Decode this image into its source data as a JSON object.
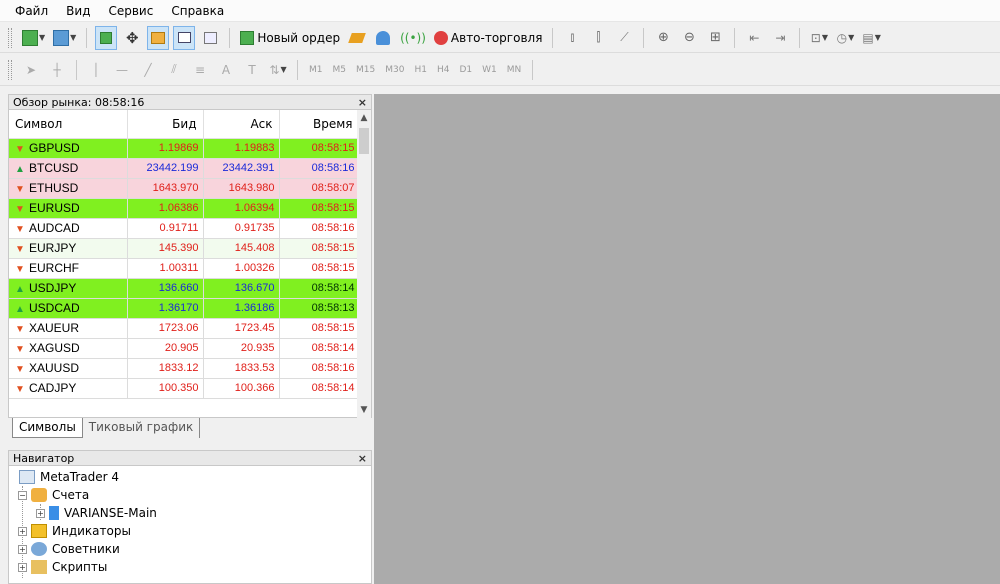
{
  "menu": [
    "Файл",
    "Вид",
    "Сервис",
    "Справка"
  ],
  "toolbar": {
    "new_order": "Новый ордер",
    "auto_trading": "Авто-торговля"
  },
  "timeframes": [
    "M1",
    "M5",
    "M15",
    "M30",
    "H1",
    "H4",
    "D1",
    "W1",
    "MN"
  ],
  "market_watch": {
    "title": "Обзор рынка: 08:58:16",
    "close": "×",
    "columns": [
      "Символ",
      "Бид",
      "Аск",
      "Время"
    ],
    "rows": [
      {
        "symbol": "GBPUSD",
        "bid": "1.19869",
        "ask": "1.19883",
        "time": "08:58:15",
        "dir": "down",
        "bg": "#80f020",
        "color": "red"
      },
      {
        "symbol": "BTCUSD",
        "bid": "23442.199",
        "ask": "23442.391",
        "time": "08:58:16",
        "dir": "up",
        "bg": "#f8d4dc",
        "color": "blue"
      },
      {
        "symbol": "ETHUSD",
        "bid": "1643.970",
        "ask": "1643.980",
        "time": "08:58:07",
        "dir": "down",
        "bg": "#f8d4dc",
        "color": "red"
      },
      {
        "symbol": "EURUSD",
        "bid": "1.06386",
        "ask": "1.06394",
        "time": "08:58:15",
        "dir": "down",
        "bg": "#80f020",
        "color": "red"
      },
      {
        "symbol": "AUDCAD",
        "bid": "0.91711",
        "ask": "0.91735",
        "time": "08:58:16",
        "dir": "down",
        "bg": "#ffffff",
        "color": "red"
      },
      {
        "symbol": "EURJPY",
        "bid": "145.390",
        "ask": "145.408",
        "time": "08:58:15",
        "dir": "down",
        "bg": "#f2fbee",
        "color": "red"
      },
      {
        "symbol": "EURCHF",
        "bid": "1.00311",
        "ask": "1.00326",
        "time": "08:58:15",
        "dir": "down",
        "bg": "#ffffff",
        "color": "red"
      },
      {
        "symbol": "USDJPY",
        "bid": "136.660",
        "ask": "136.670",
        "time": "08:58:14",
        "dir": "up",
        "bg": "#80f020",
        "color": "blue"
      },
      {
        "symbol": "USDCAD",
        "bid": "1.36170",
        "ask": "1.36186",
        "time": "08:58:13",
        "dir": "up",
        "bg": "#80f020",
        "color": "blue"
      },
      {
        "symbol": "XAUEUR",
        "bid": "1723.06",
        "ask": "1723.45",
        "time": "08:58:15",
        "dir": "down",
        "bg": "#ffffff",
        "color": "red"
      },
      {
        "symbol": "XAGUSD",
        "bid": "20.905",
        "ask": "20.935",
        "time": "08:58:14",
        "dir": "down",
        "bg": "#ffffff",
        "color": "red"
      },
      {
        "symbol": "XAUUSD",
        "bid": "1833.12",
        "ask": "1833.53",
        "time": "08:58:16",
        "dir": "down",
        "bg": "#ffffff",
        "color": "red"
      },
      {
        "symbol": "CADJPY",
        "bid": "100.350",
        "ask": "100.366",
        "time": "08:58:14",
        "dir": "down",
        "bg": "#ffffff",
        "color": "red"
      }
    ]
  },
  "tabs": [
    "Символы",
    "Тиковый график"
  ],
  "navigator": {
    "title": "Навигатор",
    "close": "×",
    "items": [
      "MetaTrader 4",
      "Счета",
      "VARIANSE-Main",
      "Индикаторы",
      "Советники",
      "Скрипты"
    ]
  },
  "colors": {
    "up_green": "#80f020",
    "pink": "#f8d4dc",
    "chart_bg": "#ababab",
    "red_text": "#e0201a",
    "blue_text": "#1a2ad8"
  }
}
